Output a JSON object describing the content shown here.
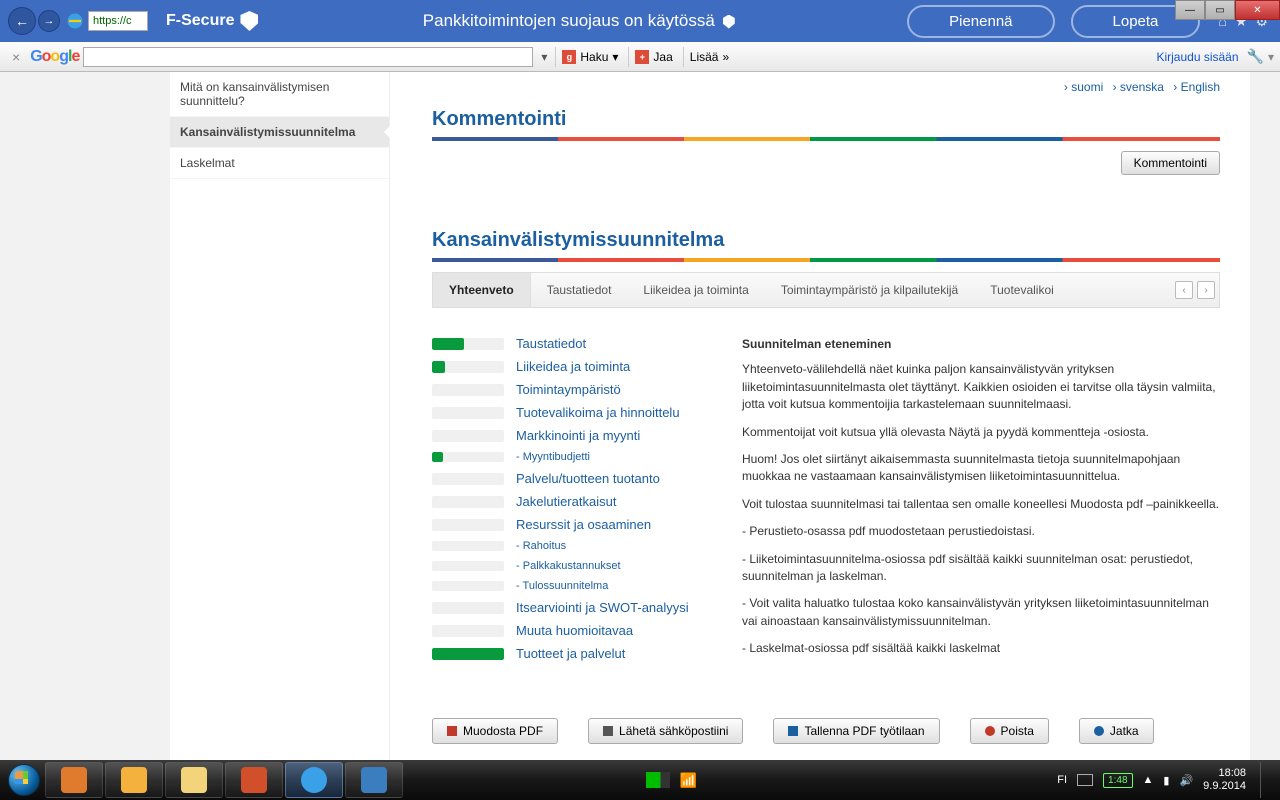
{
  "window": {
    "min": "—",
    "max": "▭",
    "close": "✕"
  },
  "browser": {
    "url_fragment": "https://c"
  },
  "fsecure": {
    "brand": "F-Secure",
    "message": "Pankkitoimintojen suojaus on käytössä",
    "btn_minimize": "Pienennä",
    "btn_stop": "Lopeta"
  },
  "gtoolbar": {
    "close": "×",
    "search_value": "",
    "haku": "Haku",
    "jaa": "Jaa",
    "lisaa": "Lisää",
    "login": "Kirjaudu sisään"
  },
  "sidebar": {
    "items": [
      {
        "label": "Mitä on kansainvälistymisen suunnittelu?",
        "active": false
      },
      {
        "label": "Kansainvälistymissuunnitelma",
        "active": true
      },
      {
        "label": "Laskelmat",
        "active": false
      }
    ]
  },
  "lang": {
    "fi": "suomi",
    "sv": "svenska",
    "en": "English"
  },
  "sections": {
    "kommentointi": "Kommentointi",
    "kv_suunnitelma": "Kansainvälistymissuunnitelma",
    "kommentointi_btn": "Kommentointi"
  },
  "tabs": [
    "Yhteenveto",
    "Taustatiedot",
    "Liikeidea ja toiminta",
    "Toimintaympäristö ja kilpailutekijä",
    "Tuotevalikoi"
  ],
  "progress": [
    {
      "label": "Taustatiedot",
      "pct": 45,
      "sub": false
    },
    {
      "label": "Liikeidea ja toiminta",
      "pct": 18,
      "sub": false
    },
    {
      "label": "Toimintaympäristö",
      "pct": 0,
      "sub": false
    },
    {
      "label": "Tuotevalikoima ja hinnoittelu",
      "pct": 0,
      "sub": false
    },
    {
      "label": "Markkinointi ja myynti",
      "pct": 0,
      "sub": false
    },
    {
      "label": "Myyntibudjetti",
      "pct": 15,
      "sub": true
    },
    {
      "label": "Palvelu/tuotteen tuotanto",
      "pct": 0,
      "sub": false
    },
    {
      "label": "Jakelutieratkaisut",
      "pct": 0,
      "sub": false
    },
    {
      "label": "Resurssit ja osaaminen",
      "pct": 0,
      "sub": false
    },
    {
      "label": "Rahoitus",
      "pct": 0,
      "sub": true
    },
    {
      "label": "Palkkakustannukset",
      "pct": 0,
      "sub": true
    },
    {
      "label": "Tulossuunnitelma",
      "pct": 0,
      "sub": true
    },
    {
      "label": "Itsearviointi ja SWOT-analyysi",
      "pct": 0,
      "sub": false
    },
    {
      "label": "Muuta huomioitavaa",
      "pct": 0,
      "sub": false
    },
    {
      "label": "Tuotteet ja palvelut",
      "pct": 100,
      "sub": false
    }
  ],
  "info": {
    "heading": "Suunnitelman eteneminen",
    "p1": "Yhteenveto-välilehdellä näet kuinka paljon kansainvälistyvän yrityksen liiketoimintasuunnitelmasta olet täyttänyt. Kaikkien osioiden ei tarvitse olla täysin valmiita, jotta voit kutsua kommentoijia tarkastelemaan suunnitelmaasi.",
    "p2": "Kommentoijat voit kutsua yllä olevasta Näytä ja pyydä kommentteja -osiosta.",
    "p3": "Huom! Jos olet siirtänyt aikaisemmasta suunnitelmasta tietoja suunnitelmapohjaan muokkaa ne vastaamaan kansainvälistymisen liiketoimintasuunnittelua.",
    "p4": "Voit tulostaa suunnitelmasi tai tallentaa sen omalle koneellesi Muodosta pdf –painikkeella.",
    "p5": "- Perustieto-osassa pdf muodostetaan perustiedoistasi.",
    "p6": "- Liiketoimintasuunnitelma-osiossa pdf sisältää kaikki suunnitelman osat: perustiedot, suunnitelman ja laskelman.",
    "p7": "- Voit valita haluatko tulostaa koko kansainvälistyvän yrityksen liiketoimintasuunnitelman vai ainoastaan kansainvälistymissuunnitelman.",
    "p8": "- Laskelmat-osiossa pdf sisältää kaikki laskelmat"
  },
  "buttons": {
    "pdf": "Muodosta PDF",
    "mail": "Lähetä sähköpostiini",
    "save": "Tallenna PDF työtilaan",
    "del": "Poista",
    "go": "Jatka"
  },
  "taskbar": {
    "lang": "FI",
    "battery": "1:48",
    "time": "18:08",
    "date": "9.9.2014"
  }
}
